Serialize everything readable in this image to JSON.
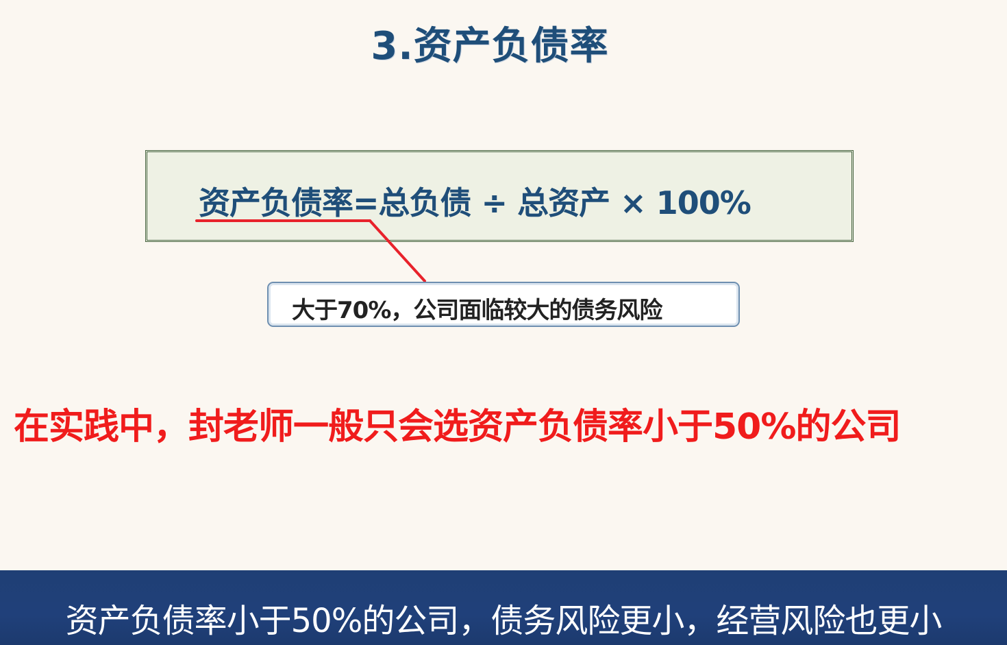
{
  "slide": {
    "title": "3.资产负债率",
    "formula": "资产负债率=总负债 ÷ 总资产 × 100%",
    "callout": "大于70%，公司面临较大的债务风险",
    "highlight": "在实践中，封老师一般只会选资产负债率小于50%的公司"
  },
  "subtitle": {
    "text": "资产负债率小于50%的公司，债务风险更小，经营风险也更小"
  },
  "colors": {
    "title": "#1f4e79",
    "highlight": "#f01c1c",
    "connector": "#e8222b",
    "subtitle_bar": "#20407a"
  }
}
